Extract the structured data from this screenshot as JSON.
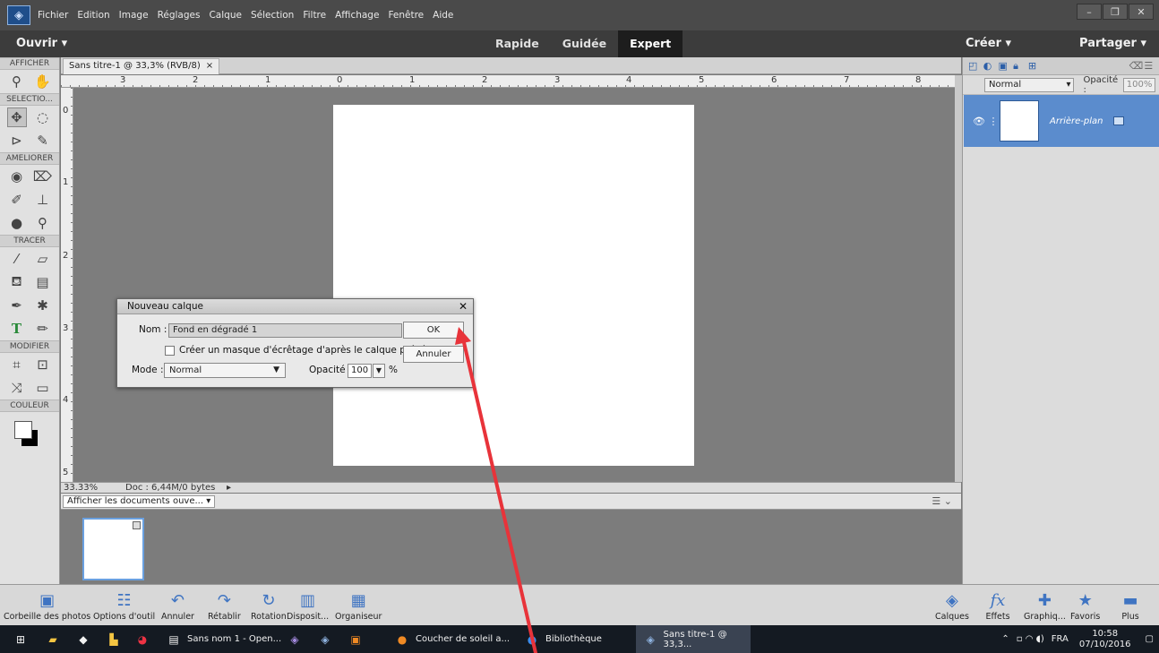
{
  "menubar": {
    "items": [
      "Fichier",
      "Edition",
      "Image",
      "Réglages",
      "Calque",
      "Sélection",
      "Filtre",
      "Affichage",
      "Fenêtre",
      "Aide"
    ]
  },
  "modebar": {
    "open": "Ouvrir",
    "modes": [
      "Rapide",
      "Guidée",
      "Expert"
    ],
    "active_mode": "Expert",
    "create": "Créer",
    "share": "Partager"
  },
  "tools": {
    "sections": {
      "view": "AFFICHER",
      "select": "SELECTIO...",
      "enhance": "AMELIORER",
      "draw": "TRACER",
      "modify": "MODIFIER",
      "color": "COULEUR"
    }
  },
  "document": {
    "tab_title": "Sans titre-1 @ 33,3% (RVB/8)",
    "tab_close": "×",
    "hruler_ticks": [
      "3",
      "2",
      "1",
      "0",
      "1",
      "2",
      "3",
      "4",
      "5",
      "6",
      "7",
      "8"
    ],
    "vruler_ticks": [
      "0",
      "1",
      "2",
      "3",
      "4",
      "5"
    ],
    "zoom": "33.33%",
    "doc_info": "Doc : 6,44M/0 bytes"
  },
  "photobin": {
    "dropdown": "Afficher les documents ouve..."
  },
  "layers": {
    "blend_mode": "Normal",
    "opacity_label": "Opacité :",
    "opacity_value": "100%",
    "layer_name": "Arrière-plan"
  },
  "bottombar": {
    "items": [
      "Corbeille des photos",
      "Options d'outil",
      "Annuler",
      "Rétablir",
      "Rotation",
      "Disposit...",
      "Organiseur",
      "Calques",
      "Effets",
      "Graphiq...",
      "Favoris",
      "Plus"
    ]
  },
  "dialog": {
    "title": "Nouveau calque",
    "name_label": "Nom :",
    "name_value": "Fond en dégradé 1",
    "clip_label": "Créer un masque d'écrêtage d'après le calque précédent",
    "mode_label": "Mode :",
    "mode_value": "Normal",
    "opacity_label": "Opacité :",
    "opacity_value": "100",
    "percent": "%",
    "ok": "OK",
    "cancel": "Annuler"
  },
  "taskbar": {
    "items": [
      "Sans nom 1 - Open...",
      "Coucher de soleil a...",
      "Bibliothèque",
      "Sans titre-1 @ 33,3..."
    ],
    "lang": "FRA",
    "time": "10:58",
    "date": "07/10/2016"
  },
  "colors": {
    "annotation_arrow": "#e8333a",
    "layer_selected": "#5b8ccd",
    "taskbar": "#141a22"
  }
}
